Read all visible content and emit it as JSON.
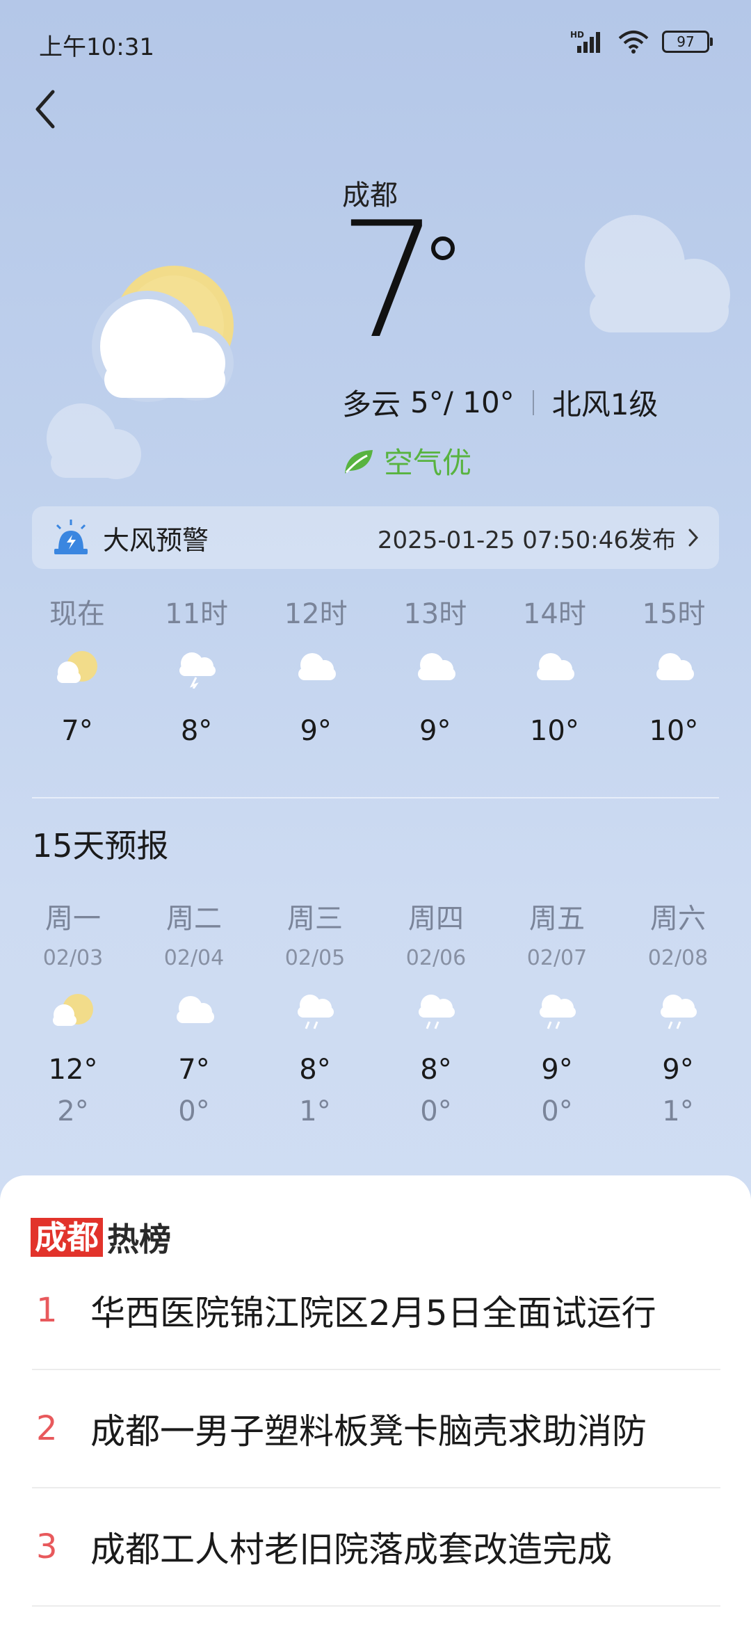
{
  "status_bar": {
    "time": "上午10:31",
    "signal_label": "HD",
    "battery": "97"
  },
  "current": {
    "city": "成都",
    "temp": "7",
    "condition": "多云",
    "range": "5°/ 10°",
    "wind": "北风1级",
    "air_quality": "空气优"
  },
  "warning": {
    "title": "大风预警",
    "time": "2025-01-25 07:50:46发布"
  },
  "hourly": [
    {
      "label": "现在",
      "temp": "7°",
      "icon": "partly-cloudy-icon"
    },
    {
      "label": "11时",
      "temp": "8°",
      "icon": "thunder-cloud-icon"
    },
    {
      "label": "12时",
      "temp": "9°",
      "icon": "cloud-icon"
    },
    {
      "label": "13时",
      "temp": "9°",
      "icon": "cloud-icon"
    },
    {
      "label": "14时",
      "temp": "10°",
      "icon": "cloud-icon"
    },
    {
      "label": "15时",
      "temp": "10°",
      "icon": "cloud-icon"
    }
  ],
  "forecast": {
    "title": "15天预报",
    "days": [
      {
        "day": "周一",
        "date": "02/03",
        "high": "12°",
        "low": "2°",
        "icon": "partly-cloudy-icon"
      },
      {
        "day": "周二",
        "date": "02/04",
        "high": "7°",
        "low": "0°",
        "icon": "cloud-icon"
      },
      {
        "day": "周三",
        "date": "02/05",
        "high": "8°",
        "low": "1°",
        "icon": "rain-cloud-icon"
      },
      {
        "day": "周四",
        "date": "02/06",
        "high": "8°",
        "low": "0°",
        "icon": "rain-cloud-icon"
      },
      {
        "day": "周五",
        "date": "02/07",
        "high": "9°",
        "low": "0°",
        "icon": "rain-cloud-icon"
      },
      {
        "day": "周六",
        "date": "02/08",
        "high": "9°",
        "low": "1°",
        "icon": "rain-cloud-icon"
      }
    ]
  },
  "hot_list": {
    "brand_a": "成都",
    "brand_b": "热榜",
    "items": [
      {
        "rank": "1",
        "title": "华西医院锦江院区2月5日全面试运行"
      },
      {
        "rank": "2",
        "title": "成都一男子塑料板凳卡脑壳求助消防"
      },
      {
        "rank": "3",
        "title": "成都工人村老旧院落成套改造完成"
      }
    ]
  },
  "colors": {
    "air_green": "#58b340",
    "rank_red": "#e8595c",
    "brand_red": "#e2332b",
    "sun_yellow": "#f2dc8a"
  }
}
